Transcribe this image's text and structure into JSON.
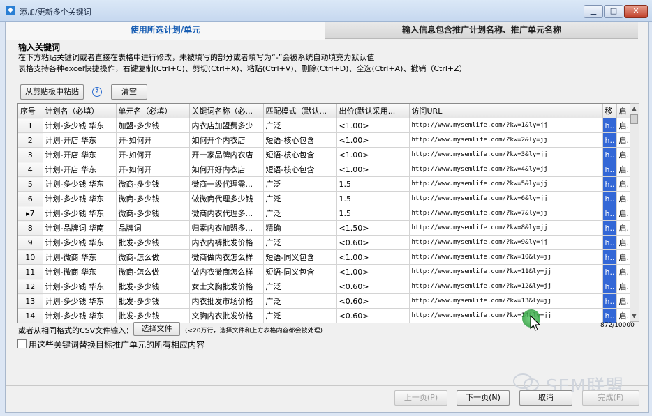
{
  "window": {
    "title": "添加/更新多个关键词",
    "minimize": "▁",
    "maximize": "□",
    "close": "✕"
  },
  "tabs": [
    {
      "label": "使用所选计划/单元"
    },
    {
      "label": "输入信息包含推广计划名称、推广单元名称"
    }
  ],
  "section_title": "输入关键词",
  "hints": [
    "在下方粘贴关键词或者直接在表格中进行修改，未被填写的部分或者填写为“-”会被系统自动填充为默认值",
    "表格支持各种excel快捷操作，右键复制(Ctrl+C)、剪切(Ctrl+X)、粘贴(Ctrl+V)、删除(Ctrl+D)、全选(Ctrl+A)、撤销（Ctrl+Z）"
  ],
  "buttons": {
    "paste": "从剪贴板中粘贴",
    "clear": "清空",
    "choose_file": "选择文件",
    "prev": "上一页(P)",
    "next": "下一页(N)",
    "cancel": "取消",
    "finish": "完成(F)"
  },
  "icons": {
    "help": "?"
  },
  "table": {
    "headers": [
      "序号",
      "计划名（必填）",
      "单元名（必填）",
      "关键词名称（必...",
      "匹配模式（默认...",
      "出价(默认采用...",
      "访问URL",
      "移",
      "启"
    ],
    "rows": [
      {
        "n": "1",
        "plan": "计划-多少钱 华东",
        "unit": "加盟-多少钱",
        "kw": "内衣店加盟费多少",
        "match": "广泛",
        "bid": "<1.00>",
        "url": "http://www.mysemlife.com/?kw=1&ly=jj",
        "m": "h..",
        "q": "启."
      },
      {
        "n": "2",
        "plan": "计划-开店 华东",
        "unit": "开-如何开",
        "kw": "如何开个内衣店",
        "match": "短语-核心包含",
        "bid": "<1.00>",
        "url": "http://www.mysemlife.com/?kw=2&ly=jj",
        "m": "h..",
        "q": "启."
      },
      {
        "n": "3",
        "plan": "计划-开店 华东",
        "unit": "开-如何开",
        "kw": "开一家品牌内衣店",
        "match": "短语-核心包含",
        "bid": "<1.00>",
        "url": "http://www.mysemlife.com/?kw=3&ly=jj",
        "m": "h..",
        "q": "启."
      },
      {
        "n": "4",
        "plan": "计划-开店 华东",
        "unit": "开-如何开",
        "kw": "如何开好内衣店",
        "match": "短语-核心包含",
        "bid": "<1.00>",
        "url": "http://www.mysemlife.com/?kw=4&ly=jj",
        "m": "h..",
        "q": "启."
      },
      {
        "n": "5",
        "plan": "计划-多少钱 华东",
        "unit": "微商-多少钱",
        "kw": "微商一级代理需...",
        "match": "广泛",
        "bid": "1.5",
        "url": "http://www.mysemlife.com/?kw=5&ly=jj",
        "m": "h..",
        "q": "启."
      },
      {
        "n": "6",
        "plan": "计划-多少钱 华东",
        "unit": "微商-多少钱",
        "kw": "做微商代理多少钱",
        "match": "广泛",
        "bid": "1.5",
        "url": "http://www.mysemlife.com/?kw=6&ly=jj",
        "m": "h..",
        "q": "启."
      },
      {
        "n": "▸7",
        "plan": "计划-多少钱 华东",
        "unit": "微商-多少钱",
        "kw": "微商内衣代理多...",
        "match": "广泛",
        "bid": "1.5",
        "url": "http://www.mysemlife.com/?kw=7&ly=jj",
        "m": "h..",
        "q": "启."
      },
      {
        "n": "8",
        "plan": "计划-品牌词 华南",
        "unit": "品牌词",
        "kw": "归素内衣加盟多...",
        "match": "精确",
        "bid": "<1.50>",
        "url": "http://www.mysemlife.com/?kw=8&ly=jj",
        "m": "h..",
        "q": "启."
      },
      {
        "n": "9",
        "plan": "计划-多少钱 华东",
        "unit": "批发-多少钱",
        "kw": "内衣内裤批发价格",
        "match": "广泛",
        "bid": "<0.60>",
        "url": "http://www.mysemlife.com/?kw=9&ly=jj",
        "m": "h..",
        "q": "启."
      },
      {
        "n": "10",
        "plan": "计划-微商 华东",
        "unit": "微商-怎么做",
        "kw": "微商做内衣怎么样",
        "match": "短语-同义包含",
        "bid": "<1.00>",
        "url": "http://www.mysemlife.com/?kw=10&ly=jj",
        "m": "h..",
        "q": "启."
      },
      {
        "n": "11",
        "plan": "计划-微商 华东",
        "unit": "微商-怎么做",
        "kw": "做内衣微商怎么样",
        "match": "短语-同义包含",
        "bid": "<1.00>",
        "url": "http://www.mysemlife.com/?kw=11&ly=jj",
        "m": "h..",
        "q": "启."
      },
      {
        "n": "12",
        "plan": "计划-多少钱 华东",
        "unit": "批发-多少钱",
        "kw": "女士文胸批发价格",
        "match": "广泛",
        "bid": "<0.60>",
        "url": "http://www.mysemlife.com/?kw=12&ly=jj",
        "m": "h..",
        "q": "启."
      },
      {
        "n": "13",
        "plan": "计划-多少钱 华东",
        "unit": "批发-多少钱",
        "kw": "内衣批发市场价格",
        "match": "广泛",
        "bid": "<0.60>",
        "url": "http://www.mysemlife.com/?kw=13&ly=jj",
        "m": "h..",
        "q": "启."
      },
      {
        "n": "14",
        "plan": "计划-多少钱 华东",
        "unit": "批发-多少钱",
        "kw": "文胸内衣批发价格",
        "match": "广泛",
        "bid": "<0.60>",
        "url": "http://www.mysemlife.com/?kw=14&ly=jj",
        "m": "h..",
        "q": "启."
      }
    ],
    "selected_col_index": 7,
    "count": "872/10000"
  },
  "csv": {
    "label": "或者从相同格式的CSV文件输入：",
    "note": "(<20万行，选择文件和上方表格内容都会被处理)"
  },
  "replace_checkbox": {
    "label": "用这些关键词替换目标推广单元的所有相应内容",
    "checked": false
  },
  "watermark": {
    "text": "SEM联盟"
  },
  "colors": {
    "accent_tab": "#1a5fb4",
    "selection": "#3367d6",
    "cursor_halo": "#2f9e3e"
  }
}
